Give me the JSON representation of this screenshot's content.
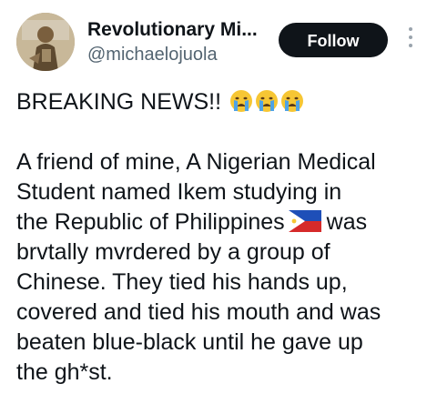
{
  "header": {
    "display_name": "Revolutionary Mi...",
    "handle": "@michaelojuola",
    "follow_label": "Follow"
  },
  "icons": {
    "avatar": "profile-photo",
    "more": "more-options-icon",
    "emoji": "loudly-crying-face-emoji",
    "flag": "philippines-flag-emoji"
  },
  "tweet": {
    "headline": "BREAKING NEWS!!",
    "lines": [
      "A friend of mine, A Nigerian Medical",
      "Student named Ikem studying in",
      "the Republic of Philippines",
      "was",
      "brvtally mvrdered by a group of",
      "Chinese. They tied his hands up,",
      "covered and tied his mouth and was",
      "beaten blue-black until he gave up",
      "the gh*st."
    ]
  }
}
